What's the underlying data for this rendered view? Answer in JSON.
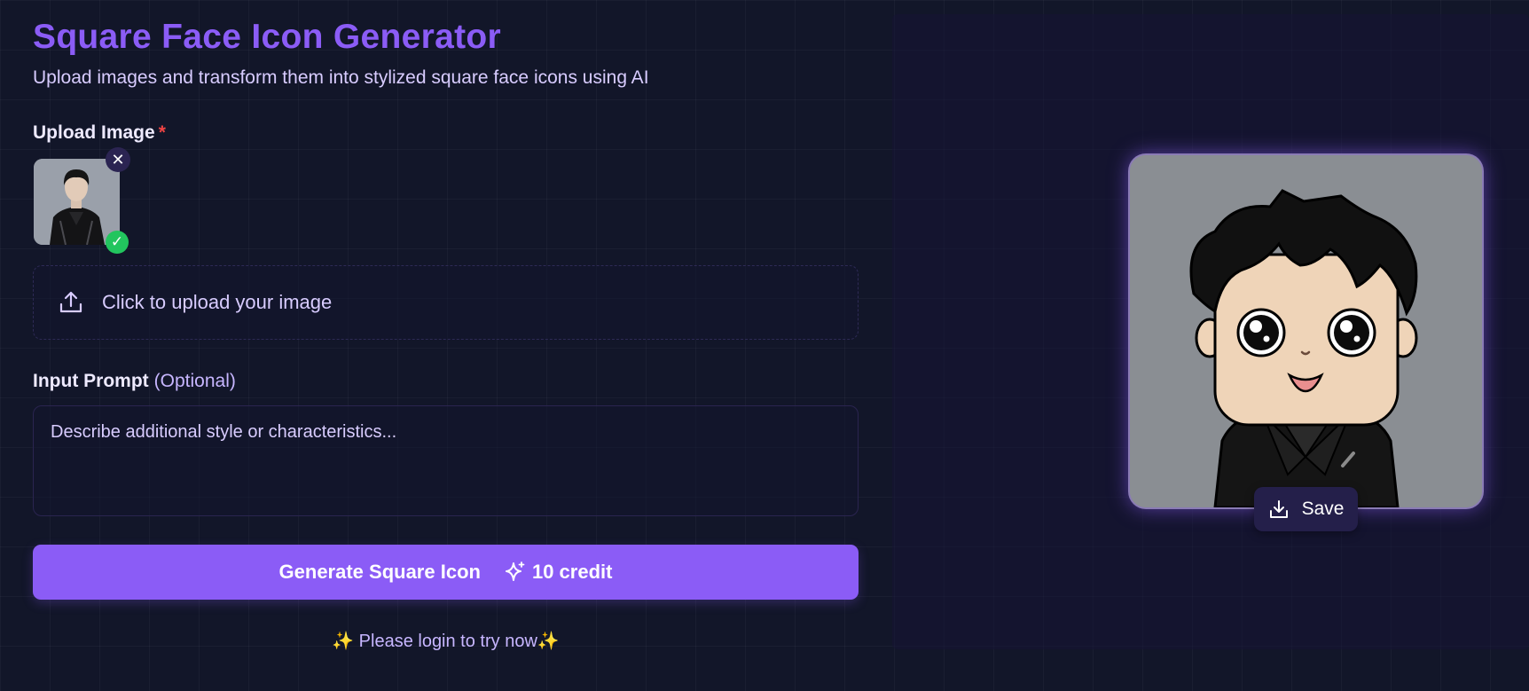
{
  "header": {
    "title": "Square Face Icon Generator",
    "subtitle": "Upload images and transform them into stylized square face icons using AI"
  },
  "upload": {
    "label": "Upload Image",
    "required_mark": "*",
    "remove_glyph": "✕",
    "check_glyph": "✓",
    "dropzone_text": "Click to upload your image",
    "icon": "upload-icon"
  },
  "prompt": {
    "label": "Input Prompt",
    "optional_text": "(Optional)",
    "placeholder": "Describe additional style or characteristics..."
  },
  "generate": {
    "label": "Generate Square Icon",
    "credit_text": "10 credit",
    "icon": "sparkle-icon"
  },
  "login_note": "✨ Please login to try now✨",
  "result": {
    "save_label": "Save",
    "icon": "download-icon"
  },
  "colors": {
    "accent": "#8b5cf6",
    "background": "#121629",
    "success": "#22c55e",
    "required": "#ef4444"
  }
}
